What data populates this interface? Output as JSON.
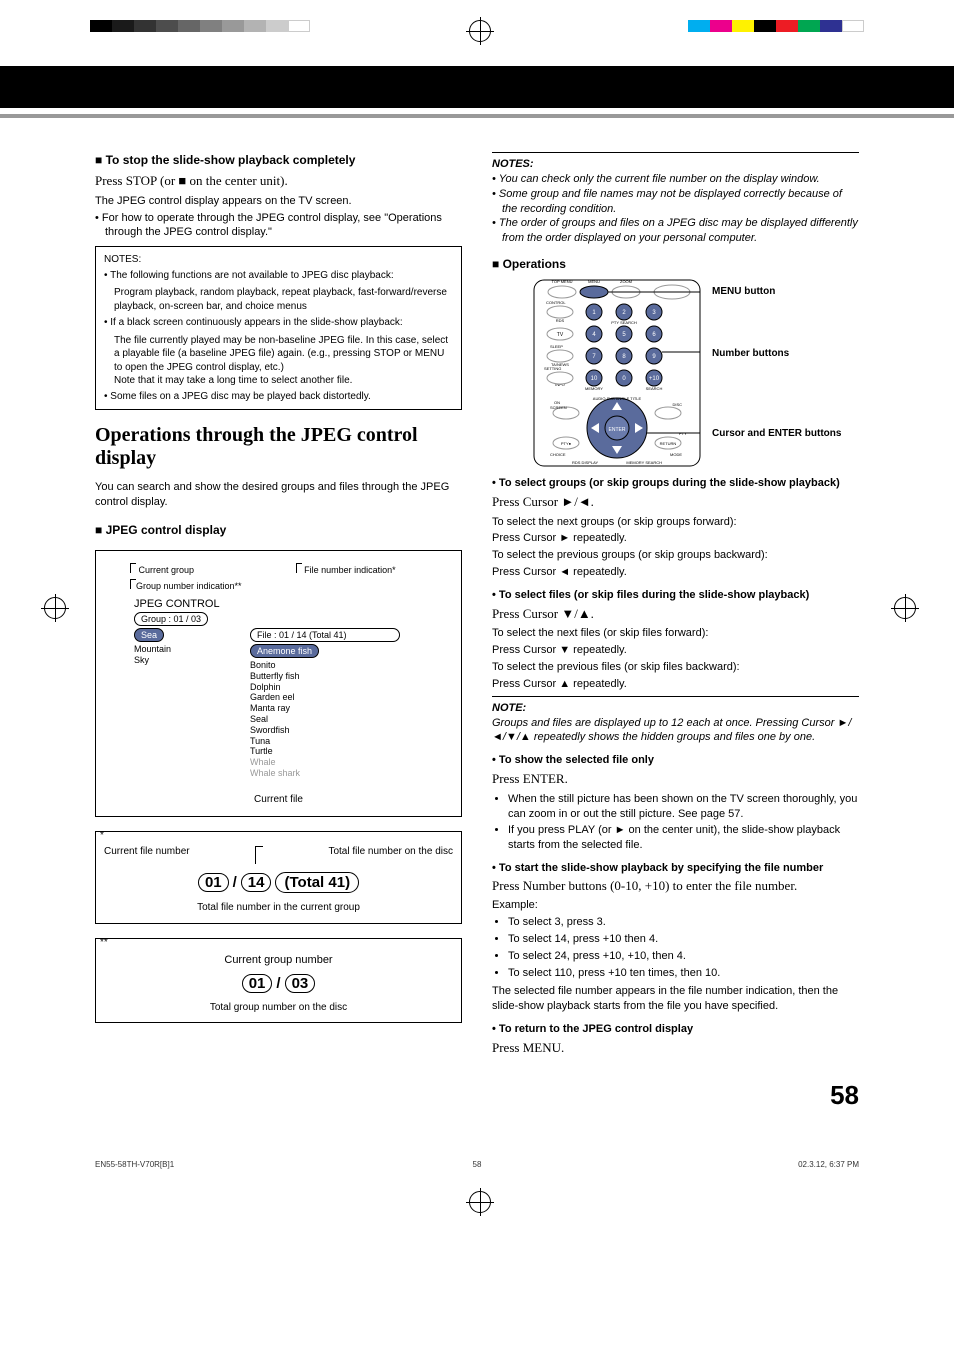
{
  "page_number": "58",
  "header_marks": {
    "bw_levels": [
      "#000",
      "#1a1a1a",
      "#333",
      "#4d4d4d",
      "#666",
      "#808080",
      "#999",
      "#b3b3b3",
      "#ccc",
      "#fff"
    ],
    "color_levels": [
      "#00aeef",
      "#ec008c",
      "#fff200",
      "#000",
      "#ed1c24",
      "#00a651",
      "#2e3192",
      "#fff"
    ]
  },
  "left": {
    "stop_head": "To stop the slide-show playback completely",
    "stop_action": "Press STOP (or ■ on the center unit).",
    "stop_body1": "The JPEG control display appears on the TV screen.",
    "stop_body2": "For how to operate through the JPEG control display, see \"Operations through the JPEG control display.\"",
    "notes_title": "NOTES:",
    "note1_lead": "The following functions are not available to JPEG disc playback:",
    "note1_body": "Program playback, random playback, repeat playback, fast-forward/reverse playback, on-screen bar, and choice menus",
    "note2_lead": "If a black screen continuously appears in the slide-show playback:",
    "note2_body": "The file currently played may be non-baseline JPEG file. In this case, select a playable file (a baseline JPEG file) again. (e.g., pressing STOP or MENU to open the JPEG control display, etc.)",
    "note2_tail": "Note that it may take a long time to select another file.",
    "note3": "Some files on a JPEG disc may be played back distortedly.",
    "main_h2": "Operations through the JPEG control display",
    "main_intro": "You can search and show the desired groups and files through the JPEG control display.",
    "jcd_head": "JPEG control display",
    "diagram": {
      "label_current_group": "Current group",
      "label_group_indication": "Group number indication**",
      "label_file_indication": "File number indication*",
      "control_title": "JPEG CONTROL",
      "group_status": "Group :  01 / 03",
      "file_status": "File :  01 / 14 (Total 41)",
      "groups": [
        "Sea",
        "Mountain",
        "Sky"
      ],
      "files": [
        "Anemone fish",
        "Bonito",
        "Butterfly fish",
        "Dolphin",
        "Garden eel",
        "Manta ray",
        "Seal",
        "Swordfish",
        "Tuna",
        "Turtle",
        "Whale",
        "Whale shark"
      ],
      "current_file_label": "Current file"
    },
    "box1": {
      "label_current_file_number": "Current file number",
      "label_total_file_disc": "Total file number on the disc",
      "nums": [
        "01",
        "14",
        "Total 41"
      ],
      "sep": "/",
      "label_total_file_group": "Total file number in the current group"
    },
    "box2": {
      "label_current_group_number": "Current group number",
      "nums": [
        "01",
        "03"
      ],
      "sep": "/",
      "label_total_group_disc": "Total group number on the disc"
    }
  },
  "right": {
    "notes_title": "NOTES:",
    "n1": "You can check only the current file number on the display window.",
    "n2": "Some group and file names may not be displayed correctly because of the recording condition.",
    "n3": "The order of groups and files on a JPEG disc may be displayed differently from the order displayed on your personal computer.",
    "operations_head": "Operations",
    "labels": {
      "menu": "MENU button",
      "number": "Number buttons",
      "cursor": "Cursor and ENTER buttons"
    },
    "remote_text": {
      "top_menu": "TOP MENU",
      "menu": "MENU",
      "zoom": "ZOOM",
      "control": "CONTROL",
      "rds": "RDS",
      "pty_search": "PTY SEARCH",
      "tv": "TV",
      "sleep": "SLEEP",
      "setting": "SETTING",
      "ta_news": "TA/NEWS",
      "info": "INFO",
      "on_screen": "ON SCREEN",
      "audio": "AUDIO",
      "sub": "SUB",
      "angle": "ANGLE",
      "title": "TITLE",
      "disc": "DISC",
      "pty": "PTY",
      "return": "RETURN",
      "mode": "MODE",
      "choice": "CHOICE",
      "rds_disp": "RDS DISPLAY",
      "memory": "MEMORY",
      "search": "SEARCH",
      "enter": "ENTER",
      "nums": [
        "1",
        "2",
        "3",
        "4",
        "5",
        "6",
        "7",
        "8",
        "9",
        "10",
        "0",
        "+10"
      ]
    },
    "sel_groups_head": "To select groups (or skip groups during the slide-show playback)",
    "sel_groups_action": "Press Cursor ►/◄.",
    "sel_groups_b1": "To select the next groups (or skip groups forward):",
    "sel_groups_b1a": "Press Cursor ► repeatedly.",
    "sel_groups_b2": "To select the previous groups (or skip groups backward):",
    "sel_groups_b2a": "Press Cursor ◄ repeatedly.",
    "sel_files_head": "To select files (or skip files during the slide-show playback)",
    "sel_files_action": "Press Cursor ▼/▲.",
    "sel_files_b1": "To select the next files (or skip files forward):",
    "sel_files_b1a": "Press Cursor ▼ repeatedly.",
    "sel_files_b2": "To select the previous files (or skip files backward):",
    "sel_files_b2a": "Press Cursor ▲ repeatedly.",
    "note_title": "NOTE:",
    "note_body": "Groups and files are displayed up to 12 each at once. Pressing Cursor ►/◄/▼/▲ repeatedly shows the hidden groups and files one by one.",
    "show_file_head": "To show the selected file only",
    "show_file_action": "Press ENTER.",
    "show_file_b1": "When the still picture has been shown on the TV screen thoroughly, you can zoom in or out the still picture. See page 57.",
    "show_file_b2": "If you press PLAY (or ► on the center unit), the slide-show playback starts from the selected file.",
    "start_head": "To start the slide-show playback by specifying the file number",
    "start_action": "Press Number buttons (0-10, +10) to enter the file number.",
    "example_label": "Example:",
    "ex1": "To select 3, press 3.",
    "ex2": "To select 14, press +10 then 4.",
    "ex3": "To select 24, press +10, +10, then 4.",
    "ex4": "To select 110, press +10 ten times, then 10.",
    "start_tail": "The selected file number appears in the file number indication, then the slide-show playback starts from the file you have specified.",
    "return_head": "To return to the JPEG control display",
    "return_action": "Press MENU."
  },
  "footer": {
    "left": "EN55-58TH-V70R[B]1",
    "center": "58",
    "right": "02.3.12, 6:37 PM"
  }
}
